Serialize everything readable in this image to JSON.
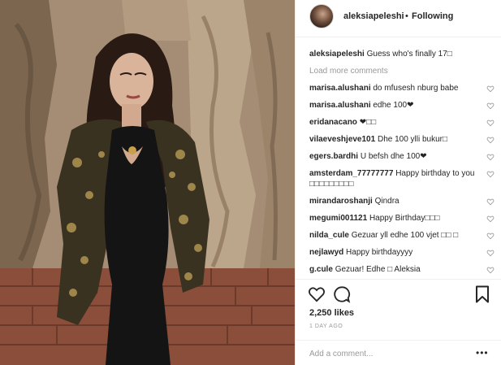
{
  "post": {
    "owner": "aleksiapeleshi",
    "separator": "•",
    "follow_label": "Following"
  },
  "caption": {
    "user": "aleksiapeleshi",
    "text": "Guess who's finally 17□"
  },
  "load_more": "Load more comments",
  "comments": [
    {
      "user": "marisa.alushani",
      "text": "do mfusesh nburg babe"
    },
    {
      "user": "marisa.alushani",
      "text": "edhe 100❤"
    },
    {
      "user": "eridanacano",
      "text": "❤□□"
    },
    {
      "user": "vilaeveshjeve101",
      "text": "Dhe 100 ylli bukur□"
    },
    {
      "user": "egers.bardhi",
      "text": "U befsh dhe 100❤"
    },
    {
      "user": "amsterdam_77777777",
      "text": "Happy birthday to you □□□□□□□□□"
    },
    {
      "user": "mirandaroshanji",
      "text": "Qindra"
    },
    {
      "user": "megumi001121",
      "text": "Happy Birthday□□□"
    },
    {
      "user": "nilda_cule",
      "text": "Gezuar yll edhe 100 vjet □□ □"
    },
    {
      "user": "nejlawyd",
      "text": "Happy birthdayyyy"
    },
    {
      "user": "g.cule",
      "text": "Gezuar! Edhe □ Aleksia"
    }
  ],
  "likes": "2,250 likes",
  "time_ago": "1 DAY AGO",
  "add_comment_placeholder": "Add a comment...",
  "more_options": "•••",
  "icons": {
    "like": "heart-icon",
    "comment": "speech-bubble-icon",
    "save": "bookmark-icon",
    "comment_like": "small-heart-icon"
  }
}
